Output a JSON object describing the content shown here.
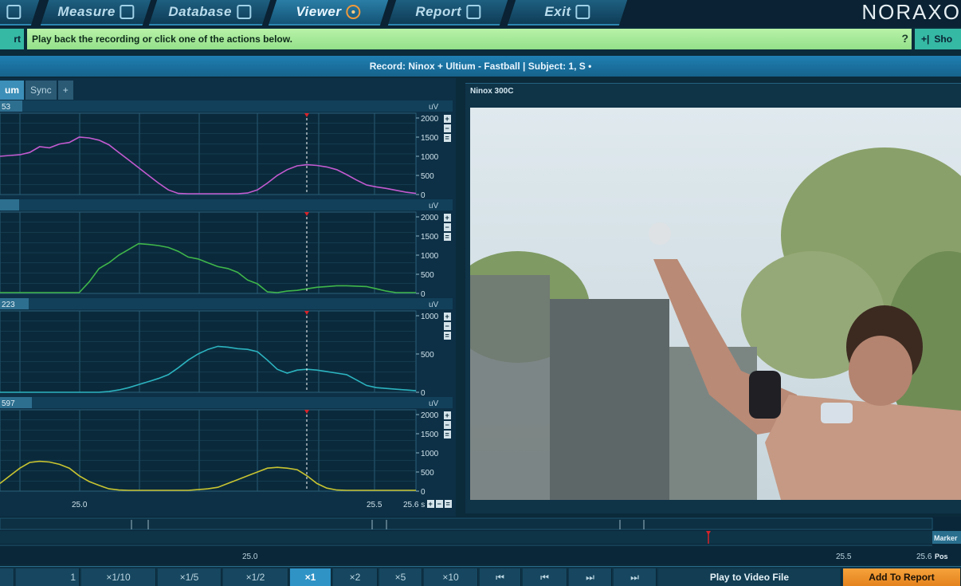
{
  "nav": {
    "tabs": [
      {
        "label": "Measure",
        "icon": "measure-icon"
      },
      {
        "label": "Database",
        "icon": "database-icon"
      },
      {
        "label": "Viewer",
        "icon": "viewer-globe-icon",
        "active": true
      },
      {
        "label": "Report",
        "icon": "report-icon"
      },
      {
        "label": "Exit",
        "icon": "exit-icon"
      }
    ],
    "brand": "NORAXO"
  },
  "infobar": {
    "left_button": "rt",
    "hint": "Play back the recording or click one of the actions below.",
    "help": "?",
    "show_button": "Sho",
    "show_icon": "+|"
  },
  "record": {
    "title": "Record: Ninox + Ultium - Fastball | Subject: 1, S •"
  },
  "left": {
    "subtabs": [
      "um",
      "Sync",
      "+"
    ],
    "channels": [
      {
        "label": "53",
        "unit": "uV",
        "ticks": [
          "2000",
          "1500",
          "1000",
          "500",
          "0"
        ],
        "max": 2000,
        "color": "#c35ad0",
        "values": [
          1000,
          1020,
          1040,
          1100,
          1250,
          1220,
          1320,
          1360,
          1500,
          1480,
          1420,
          1300,
          1100,
          900,
          700,
          500,
          300,
          120,
          30,
          20,
          20,
          20,
          20,
          20,
          20,
          40,
          120,
          300,
          500,
          650,
          750,
          780,
          760,
          720,
          650,
          520,
          380,
          250,
          200,
          160,
          110,
          60,
          30
        ]
      },
      {
        "label": "",
        "unit": "uV",
        "ticks": [
          "2000",
          "1500",
          "1000",
          "500",
          "0"
        ],
        "max": 2000,
        "color": "#3fb64a",
        "values": [
          20,
          20,
          20,
          20,
          20,
          20,
          20,
          20,
          20,
          300,
          650,
          800,
          1000,
          1150,
          1300,
          1280,
          1250,
          1200,
          1100,
          950,
          900,
          800,
          700,
          650,
          550,
          350,
          250,
          40,
          20,
          60,
          80,
          120,
          160,
          180,
          200,
          200,
          190,
          180,
          120,
          60,
          20,
          20,
          20
        ]
      },
      {
        "label": "223",
        "unit": "uV",
        "ticks": [
          "1000",
          "500",
          "0"
        ],
        "max": 1000,
        "color": "#2cb3bf",
        "values": [
          0,
          0,
          0,
          0,
          0,
          0,
          0,
          0,
          0,
          0,
          0,
          10,
          30,
          60,
          100,
          140,
          180,
          230,
          320,
          420,
          500,
          560,
          600,
          590,
          570,
          560,
          530,
          420,
          300,
          250,
          290,
          300,
          290,
          270,
          250,
          230,
          160,
          90,
          60,
          50,
          40,
          30,
          20
        ]
      },
      {
        "label": "597",
        "unit": "uV",
        "ticks": [
          "2000",
          "1500",
          "1000",
          "500",
          "0"
        ],
        "max": 2000,
        "color": "#c9c431",
        "values": [
          200,
          400,
          600,
          750,
          780,
          760,
          700,
          600,
          400,
          250,
          150,
          60,
          30,
          20,
          20,
          20,
          20,
          20,
          20,
          20,
          40,
          60,
          100,
          200,
          300,
          400,
          500,
          600,
          620,
          600,
          560,
          400,
          200,
          80,
          30,
          20,
          20,
          20,
          20,
          20,
          20,
          20,
          20
        ]
      }
    ],
    "x_ticks": [
      "25.0",
      "25.5",
      "25.6 s"
    ],
    "zoom_controls": [
      "+",
      "−",
      "="
    ]
  },
  "video": {
    "label": "Ninox 300C"
  },
  "timeline": {
    "ticks": [
      "25.0",
      "25.5",
      "25.6"
    ],
    "marker_label": "Marker",
    "pos_label": "Pos"
  },
  "controls": {
    "frame_value": "1",
    "speeds": [
      "×1/10",
      "×1/5",
      "×1/2",
      "×1",
      "×2",
      "×5",
      "×10"
    ],
    "active_speed": "×1",
    "transport": [
      "⏮",
      "⏮",
      "⏭",
      "⏭"
    ],
    "play_to_video": "Play to Video File",
    "add_to_report": "Add To Report"
  },
  "colors": {
    "accent": "#2f93c6",
    "hint_bg": "#a6ea96",
    "report_btn": "#f39a31",
    "cursor": "#d8232a"
  }
}
